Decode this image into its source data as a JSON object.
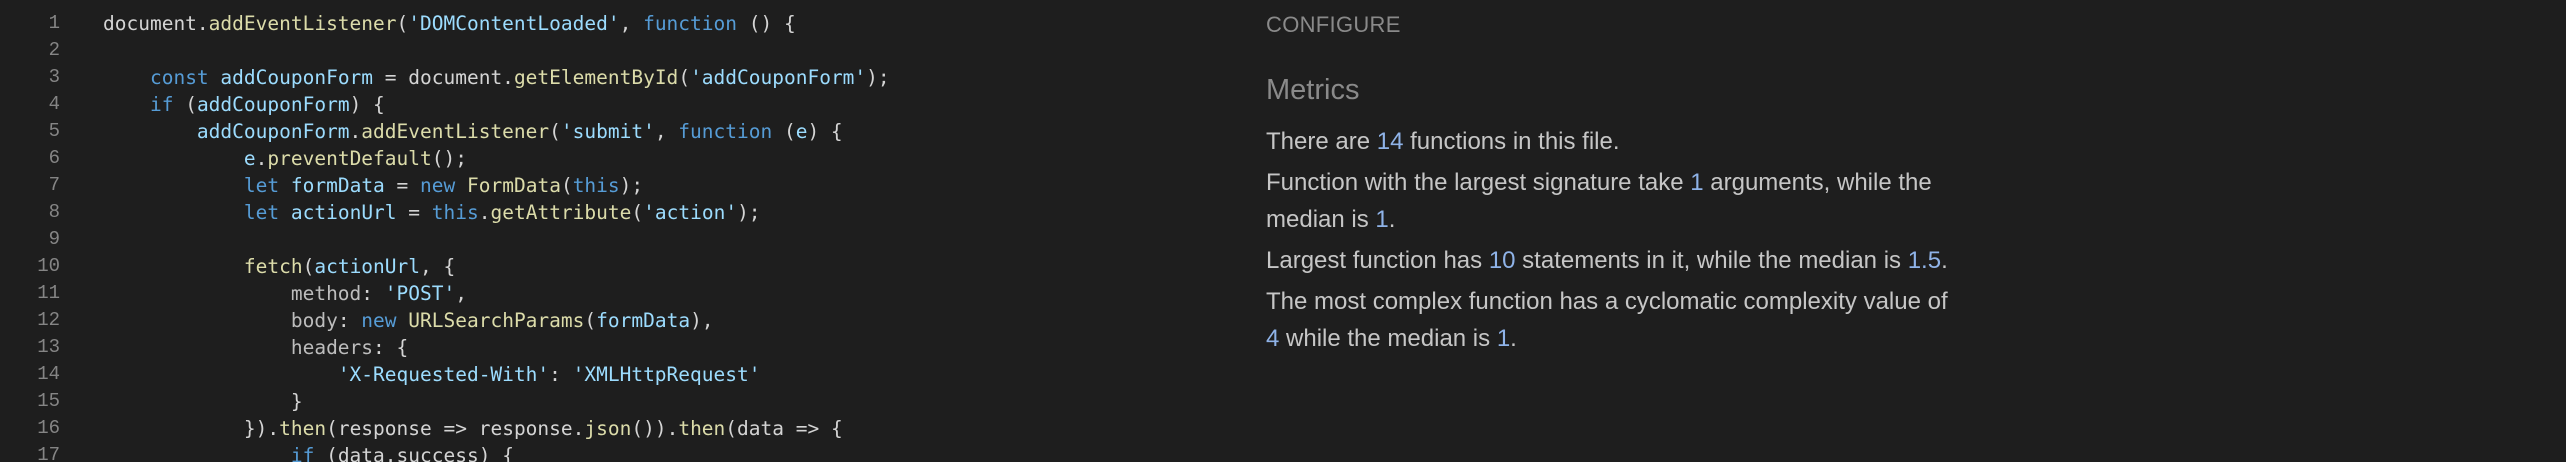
{
  "editor": {
    "lines": [
      {
        "n": "1",
        "tokens": [
          [
            "t-plain",
            "document."
          ],
          [
            "t-fn",
            "addEventListener"
          ],
          [
            "t-plain",
            "("
          ],
          [
            "t-str",
            "'DOMContentLoaded'"
          ],
          [
            "t-plain",
            ", "
          ],
          [
            "t-this",
            "function"
          ],
          [
            "t-plain",
            " () {"
          ]
        ]
      },
      {
        "n": "2",
        "tokens": []
      },
      {
        "n": "3",
        "tokens": [
          [
            "t-plain",
            "    "
          ],
          [
            "t-this",
            "const"
          ],
          [
            "t-plain",
            " "
          ],
          [
            "t-var",
            "addCouponForm"
          ],
          [
            "t-plain",
            " = document."
          ],
          [
            "t-fn",
            "getElementById"
          ],
          [
            "t-plain",
            "("
          ],
          [
            "t-str",
            "'addCouponForm'"
          ],
          [
            "t-plain",
            ");"
          ]
        ]
      },
      {
        "n": "4",
        "tokens": [
          [
            "t-plain",
            "    "
          ],
          [
            "t-this",
            "if"
          ],
          [
            "t-plain",
            " ("
          ],
          [
            "t-var",
            "addCouponForm"
          ],
          [
            "t-plain",
            ") {"
          ]
        ]
      },
      {
        "n": "5",
        "tokens": [
          [
            "t-plain",
            "        "
          ],
          [
            "t-var",
            "addCouponForm"
          ],
          [
            "t-plain",
            "."
          ],
          [
            "t-fn",
            "addEventListener"
          ],
          [
            "t-plain",
            "("
          ],
          [
            "t-str",
            "'submit'"
          ],
          [
            "t-plain",
            ", "
          ],
          [
            "t-this",
            "function"
          ],
          [
            "t-plain",
            " ("
          ],
          [
            "t-var",
            "e"
          ],
          [
            "t-plain",
            ") {"
          ]
        ]
      },
      {
        "n": "6",
        "tokens": [
          [
            "t-plain",
            "            "
          ],
          [
            "t-var",
            "e"
          ],
          [
            "t-plain",
            "."
          ],
          [
            "t-fn",
            "preventDefault"
          ],
          [
            "t-plain",
            "();"
          ]
        ]
      },
      {
        "n": "7",
        "tokens": [
          [
            "t-plain",
            "            "
          ],
          [
            "t-this",
            "let"
          ],
          [
            "t-plain",
            " "
          ],
          [
            "t-var",
            "formData"
          ],
          [
            "t-plain",
            " = "
          ],
          [
            "t-this",
            "new"
          ],
          [
            "t-plain",
            " "
          ],
          [
            "t-fn",
            "FormData"
          ],
          [
            "t-plain",
            "("
          ],
          [
            "t-this",
            "this"
          ],
          [
            "t-plain",
            ");"
          ]
        ]
      },
      {
        "n": "8",
        "tokens": [
          [
            "t-plain",
            "            "
          ],
          [
            "t-this",
            "let"
          ],
          [
            "t-plain",
            " "
          ],
          [
            "t-var",
            "actionUrl"
          ],
          [
            "t-plain",
            " = "
          ],
          [
            "t-this",
            "this"
          ],
          [
            "t-plain",
            "."
          ],
          [
            "t-fn",
            "getAttribute"
          ],
          [
            "t-plain",
            "("
          ],
          [
            "t-str",
            "'action'"
          ],
          [
            "t-plain",
            ");"
          ]
        ]
      },
      {
        "n": "9",
        "tokens": []
      },
      {
        "n": "10",
        "tokens": [
          [
            "t-plain",
            "            "
          ],
          [
            "t-fn",
            "fetch"
          ],
          [
            "t-plain",
            "("
          ],
          [
            "t-var",
            "actionUrl"
          ],
          [
            "t-plain",
            ", {"
          ]
        ]
      },
      {
        "n": "11",
        "tokens": [
          [
            "t-plain",
            "                "
          ],
          [
            "t-mute",
            "method"
          ],
          [
            "t-plain",
            ": "
          ],
          [
            "t-str",
            "'POST'"
          ],
          [
            "t-plain",
            ","
          ]
        ]
      },
      {
        "n": "12",
        "tokens": [
          [
            "t-plain",
            "                "
          ],
          [
            "t-mute",
            "body"
          ],
          [
            "t-plain",
            ": "
          ],
          [
            "t-this",
            "new"
          ],
          [
            "t-plain",
            " "
          ],
          [
            "t-fn",
            "URLSearchParams"
          ],
          [
            "t-plain",
            "("
          ],
          [
            "t-var",
            "formData"
          ],
          [
            "t-plain",
            "),"
          ]
        ]
      },
      {
        "n": "13",
        "tokens": [
          [
            "t-plain",
            "                "
          ],
          [
            "t-mute",
            "headers"
          ],
          [
            "t-plain",
            ": {"
          ]
        ]
      },
      {
        "n": "14",
        "tokens": [
          [
            "t-plain",
            "                    "
          ],
          [
            "t-str",
            "'X-Requested-With'"
          ],
          [
            "t-plain",
            ": "
          ],
          [
            "t-str",
            "'XMLHttpRequest'"
          ]
        ]
      },
      {
        "n": "15",
        "tokens": [
          [
            "t-plain",
            "                }"
          ]
        ]
      },
      {
        "n": "16",
        "tokens": [
          [
            "t-plain",
            "            })."
          ],
          [
            "t-fn",
            "then"
          ],
          [
            "t-plain",
            "("
          ],
          [
            "t-plain",
            "response"
          ],
          [
            "t-plain",
            " => "
          ],
          [
            "t-plain",
            "response"
          ],
          [
            "t-plain",
            "."
          ],
          [
            "t-fn",
            "json"
          ],
          [
            "t-plain",
            "())."
          ],
          [
            "t-fn",
            "then"
          ],
          [
            "t-plain",
            "("
          ],
          [
            "t-plain",
            "data"
          ],
          [
            "t-plain",
            " => {"
          ]
        ]
      },
      {
        "n": "17",
        "tokens": [
          [
            "t-plain",
            "                "
          ],
          [
            "t-this",
            "if"
          ],
          [
            "t-plain",
            " ("
          ],
          [
            "t-plain",
            "data"
          ],
          [
            "t-plain",
            "."
          ],
          [
            "t-plain",
            "success"
          ],
          [
            "t-plain",
            ") {"
          ]
        ]
      }
    ]
  },
  "panel": {
    "configure_label": "CONFIGURE",
    "metrics_title": "Metrics",
    "p1": {
      "a": "There are ",
      "n1": "14",
      "b": " functions in this file."
    },
    "p2": {
      "a": "Function with the largest signature take ",
      "n1": "1",
      "b": " arguments, while the median is ",
      "n2": "1",
      "c": "."
    },
    "p3": {
      "a": "Largest function has ",
      "n1": "10",
      "b": " statements in it, while the median is ",
      "n2": "1.5",
      "c": "."
    },
    "p4": {
      "a": "The most complex function has a cyclomatic complexity value of ",
      "n1": "4",
      "b": " while the median is ",
      "n2": "1",
      "c": "."
    }
  },
  "colors": {
    "background": "#1e1e1e",
    "number_highlight": "#8fb3e8",
    "line_number": "#858585"
  }
}
